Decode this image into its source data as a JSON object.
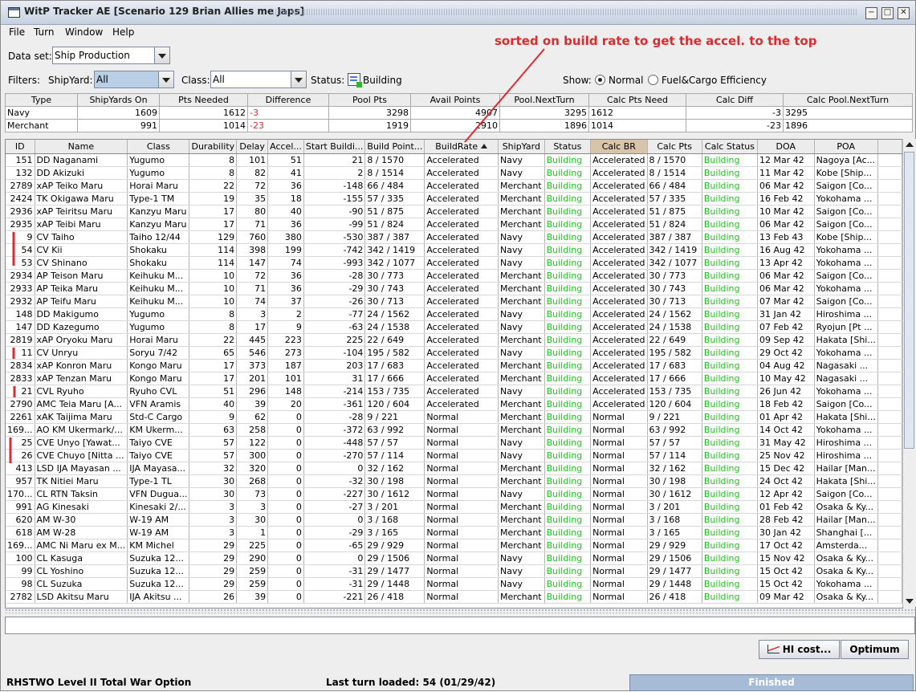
{
  "window": {
    "title": "WitP Tracker AE [Scenario 129 Brian Allies me Japs]"
  },
  "menu": [
    "File",
    "Turn",
    "Window",
    "Help"
  ],
  "annotation": "sorted on build rate to get the accel. to the  top",
  "dataset": {
    "label": "Data set:",
    "value": "Ship Production"
  },
  "filters": {
    "label": "Filters:",
    "shipyard_label": "ShipYard:",
    "shipyard_value": "All",
    "class_label": "Class:",
    "class_value": "All",
    "status_label": "Status:",
    "status_value": "Building"
  },
  "show": {
    "label": "Show:",
    "normal": "Normal",
    "fuel": "Fuel&Cargo Efficiency"
  },
  "summary": {
    "headers": [
      "Type",
      "ShipYards On",
      "Pts Needed",
      "Difference",
      "Pool Pts",
      "Avail Points",
      "Pool.NextTurn",
      "Calc Pts Need",
      "Calc Diff",
      "Calc Pool.NextTurn"
    ],
    "rows": [
      [
        "Navy",
        "1609",
        "1612",
        "-3",
        "3298",
        "4907",
        "3295",
        "1612",
        "-3",
        "3295"
      ],
      [
        "Merchant",
        "991",
        "1014",
        "-23",
        "1919",
        "2910",
        "1896",
        "1014",
        "-23",
        "1896"
      ]
    ]
  },
  "table": {
    "headers": [
      "ID",
      "Name",
      "Class",
      "Durability",
      "Delay",
      "Accel...",
      "Start Buildi...",
      "Build Point...",
      "BuildRate",
      "ShipYard",
      "Status",
      "Calc BR",
      "Calc Pts",
      "Calc Status",
      "DOA",
      "POA"
    ],
    "rows": [
      [
        "151",
        "DD Naganami",
        "Yugumo",
        "8",
        "101",
        "51",
        "21",
        "8 / 1570",
        "Accelerated",
        "Navy",
        "Building",
        "Accelerated",
        "8 / 1570",
        "Building",
        "12 Mar 42",
        "Nagoya [Ac..."
      ],
      [
        "132",
        "DD Akizuki",
        "Yugumo",
        "8",
        "82",
        "41",
        "2",
        "8 / 1514",
        "Accelerated",
        "Navy",
        "Building",
        "Accelerated",
        "8 / 1514",
        "Building",
        "11 Mar 42",
        "Kobe [Ship..."
      ],
      [
        "2789",
        "xAP Teiko Maru",
        "Horai Maru",
        "22",
        "72",
        "36",
        "-148",
        "66 / 484",
        "Accelerated",
        "Merchant",
        "Building",
        "Accelerated",
        "66 / 484",
        "Building",
        "06 Mar 42",
        "Saigon [Co..."
      ],
      [
        "2424",
        "TK Okigawa Maru",
        "Type-1 TM",
        "19",
        "35",
        "18",
        "-155",
        "57 / 335",
        "Accelerated",
        "Merchant",
        "Building",
        "Accelerated",
        "57 / 335",
        "Building",
        "16 Feb 42",
        "Yokohama ..."
      ],
      [
        "2936",
        "xAP Teiritsu Maru",
        "Kanzyu Maru",
        "17",
        "80",
        "40",
        "-90",
        "51 / 875",
        "Accelerated",
        "Merchant",
        "Building",
        "Accelerated",
        "51 / 875",
        "Building",
        "10 Mar 42",
        "Saigon [Co..."
      ],
      [
        "2935",
        "xAP Teibi Maru",
        "Kanzyu Maru",
        "17",
        "71",
        "36",
        "-99",
        "51 / 824",
        "Accelerated",
        "Merchant",
        "Building",
        "Accelerated",
        "51 / 824",
        "Building",
        "06 Mar 42",
        "Saigon [Co..."
      ],
      [
        "9",
        "CV Taiho",
        "Taiho 12/44",
        "129",
        "760",
        "380",
        "-530",
        "387 / 387",
        "Accelerated",
        "Navy",
        "Building",
        "Accelerated",
        "387 / 387",
        "Building",
        "13 Feb 43",
        "Kobe [Ship..."
      ],
      [
        "54",
        "CV Kii",
        "Shokaku",
        "114",
        "398",
        "199",
        "-742",
        "342 / 1419",
        "Accelerated",
        "Navy",
        "Building",
        "Accelerated",
        "342 / 1419",
        "Building",
        "16 Aug 42",
        "Yokohama ..."
      ],
      [
        "53",
        "CV Shinano",
        "Shokaku",
        "114",
        "147",
        "74",
        "-993",
        "342 / 1077",
        "Accelerated",
        "Navy",
        "Building",
        "Accelerated",
        "342 / 1077",
        "Building",
        "13 Apr 42",
        "Yokohama ..."
      ],
      [
        "2934",
        "AP Teison Maru",
        "Keihuku M...",
        "10",
        "72",
        "36",
        "-28",
        "30 / 773",
        "Accelerated",
        "Merchant",
        "Building",
        "Accelerated",
        "30 / 773",
        "Building",
        "06 Mar 42",
        "Saigon [Co..."
      ],
      [
        "2933",
        "AP Teika Maru",
        "Keihuku M...",
        "10",
        "71",
        "36",
        "-29",
        "30 / 743",
        "Accelerated",
        "Merchant",
        "Building",
        "Accelerated",
        "30 / 743",
        "Building",
        "06 Mar 42",
        "Yokohama ..."
      ],
      [
        "2932",
        "AP Teifu Maru",
        "Keihuku M...",
        "10",
        "74",
        "37",
        "-26",
        "30 / 713",
        "Accelerated",
        "Merchant",
        "Building",
        "Accelerated",
        "30 / 713",
        "Building",
        "07 Mar 42",
        "Saigon [Co..."
      ],
      [
        "148",
        "DD Makigumo",
        "Yugumo",
        "8",
        "3",
        "2",
        "-77",
        "24 / 1562",
        "Accelerated",
        "Navy",
        "Building",
        "Accelerated",
        "24 / 1562",
        "Building",
        "31 Jan 42",
        "Hiroshima ..."
      ],
      [
        "147",
        "DD Kazegumo",
        "Yugumo",
        "8",
        "17",
        "9",
        "-63",
        "24 / 1538",
        "Accelerated",
        "Navy",
        "Building",
        "Accelerated",
        "24 / 1538",
        "Building",
        "07 Feb 42",
        "Ryojun [Pt ..."
      ],
      [
        "2819",
        "xAP Oryoku Maru",
        "Horai Maru",
        "22",
        "445",
        "223",
        "225",
        "22 / 649",
        "Accelerated",
        "Merchant",
        "Building",
        "Accelerated",
        "22 / 649",
        "Building",
        "09 Sep 42",
        "Hakata [Shi..."
      ],
      [
        "11",
        "CV Unryu",
        "Soryu 7/42",
        "65",
        "546",
        "273",
        "-104",
        "195 / 582",
        "Accelerated",
        "Navy",
        "Building",
        "Accelerated",
        "195 / 582",
        "Building",
        "29 Oct 42",
        "Yokohama ..."
      ],
      [
        "2834",
        "xAP Konron Maru",
        "Kongo Maru",
        "17",
        "373",
        "187",
        "203",
        "17 / 683",
        "Accelerated",
        "Merchant",
        "Building",
        "Accelerated",
        "17 / 683",
        "Building",
        "04 Aug 42",
        "Nagasaki ..."
      ],
      [
        "2833",
        "xAP Tenzan Maru",
        "Kongo Maru",
        "17",
        "201",
        "101",
        "31",
        "17 / 666",
        "Accelerated",
        "Merchant",
        "Building",
        "Accelerated",
        "17 / 666",
        "Building",
        "10 May 42",
        "Nagasaki ..."
      ],
      [
        "21",
        "CVL Ryuho",
        "Ryuho CVL",
        "51",
        "296",
        "148",
        "-214",
        "153 / 735",
        "Accelerated",
        "Navy",
        "Building",
        "Accelerated",
        "153 / 735",
        "Building",
        "26 Jun 42",
        "Yokohama ..."
      ],
      [
        "2790",
        "AMC Teia Maru [A...",
        "VFN Aramis",
        "40",
        "39",
        "20",
        "-361",
        "120 / 604",
        "Accelerated",
        "Merchant",
        "Building",
        "Accelerated",
        "120 / 604",
        "Building",
        "18 Feb 42",
        "Saigon [Co..."
      ],
      [
        "2261",
        "xAK Taijima Maru",
        "Std-C Cargo",
        "9",
        "62",
        "0",
        "-28",
        "9 / 221",
        "Normal",
        "Merchant",
        "Building",
        "Normal",
        "9 / 221",
        "Building",
        "01 Apr 42",
        "Hakata [Shi..."
      ],
      [
        "169...",
        "AO KM Ukermark/...",
        "KM Ukerm...",
        "63",
        "258",
        "0",
        "-372",
        "63 / 992",
        "Normal",
        "Merchant",
        "Building",
        "Normal",
        "63 / 992",
        "Building",
        "14 Oct 42",
        "Yokohama ..."
      ],
      [
        "25",
        "CVE Unyo [Yawat...",
        "Taiyo CVE",
        "57",
        "122",
        "0",
        "-448",
        "57 / 57",
        "Normal",
        "Navy",
        "Building",
        "Normal",
        "57 / 57",
        "Building",
        "31 May 42",
        "Hiroshima ..."
      ],
      [
        "26",
        "CVE Chuyo [Nitta ...",
        "Taiyo CVE",
        "57",
        "300",
        "0",
        "-270",
        "57 / 114",
        "Normal",
        "Navy",
        "Building",
        "Normal",
        "57 / 114",
        "Building",
        "25 Nov 42",
        "Hiroshima ..."
      ],
      [
        "413",
        "LSD IJA Mayasan ...",
        "IJA Mayasa...",
        "32",
        "320",
        "0",
        "0",
        "32 / 162",
        "Normal",
        "Merchant",
        "Building",
        "Normal",
        "32 / 162",
        "Building",
        "15 Dec 42",
        "Hailar [Man..."
      ],
      [
        "957",
        "TK Nitiei Maru",
        "Type-1 TL",
        "30",
        "268",
        "0",
        "-32",
        "30 / 198",
        "Normal",
        "Merchant",
        "Building",
        "Normal",
        "30 / 198",
        "Building",
        "24 Oct 42",
        "Hakata [Shi..."
      ],
      [
        "170...",
        "CL RTN Taksin",
        "VFN Dugua...",
        "30",
        "73",
        "0",
        "-227",
        "30 / 1612",
        "Normal",
        "Navy",
        "Building",
        "Normal",
        "30 / 1612",
        "Building",
        "12 Apr 42",
        "Saigon [Co..."
      ],
      [
        "991",
        "AG Kinesaki",
        "Kinesaki 2/...",
        "3",
        "3",
        "0",
        "-27",
        "3 / 201",
        "Normal",
        "Merchant",
        "Building",
        "Normal",
        "3 / 201",
        "Building",
        "01 Feb 42",
        "Osaka & Ky..."
      ],
      [
        "620",
        "AM W-30",
        "W-19 AM",
        "3",
        "30",
        "0",
        "0",
        "3 / 168",
        "Normal",
        "Merchant",
        "Building",
        "Normal",
        "3 / 168",
        "Building",
        "28 Feb 42",
        "Hailar [Man..."
      ],
      [
        "618",
        "AM W-28",
        "W-19 AM",
        "3",
        "1",
        "0",
        "-29",
        "3 / 165",
        "Normal",
        "Merchant",
        "Building",
        "Normal",
        "3 / 165",
        "Building",
        "30 Jan 42",
        "Shanghai [..."
      ],
      [
        "169...",
        "AMC Ni Maru ex M...",
        "KM Michel",
        "29",
        "225",
        "0",
        "-65",
        "29 / 929",
        "Normal",
        "Merchant",
        "Building",
        "Normal",
        "29 / 929",
        "Building",
        "17 Oct 42",
        "Amsterda..."
      ],
      [
        "100",
        "CL Kasuga",
        "Suzuka 12...",
        "29",
        "290",
        "0",
        "0",
        "29 / 1506",
        "Normal",
        "Navy",
        "Building",
        "Normal",
        "29 / 1506",
        "Building",
        "15 Nov 42",
        "Osaka & Ky..."
      ],
      [
        "99",
        "CL Yoshino",
        "Suzuka 12...",
        "29",
        "259",
        "0",
        "-31",
        "29 / 1477",
        "Normal",
        "Navy",
        "Building",
        "Normal",
        "29 / 1477",
        "Building",
        "15 Oct 42",
        "Osaka & Ky..."
      ],
      [
        "98",
        "CL Suzuka",
        "Suzuka 12...",
        "29",
        "259",
        "0",
        "-31",
        "29 / 1448",
        "Normal",
        "Navy",
        "Building",
        "Normal",
        "29 / 1448",
        "Building",
        "15 Oct 42",
        "Yokohama ..."
      ],
      [
        "2782",
        "LSD Akitsu Maru",
        "IJA Akitsu ...",
        "26",
        "39",
        "0",
        "-221",
        "26 / 418",
        "Normal",
        "Merchant",
        "Building",
        "Normal",
        "26 / 418",
        "Building",
        "09 Mar 42",
        "Osaka & Ky..."
      ]
    ]
  },
  "buttons": {
    "hi_cost": "HI cost...",
    "optimum": "Optimum"
  },
  "footer": {
    "left": "RHSTWO Level II Total War Option",
    "center": "Last turn loaded: 54 (01/29/42)",
    "progress": "Finished"
  },
  "colors": {
    "accent_red": "#e0282f",
    "building_green": "#1cc21c",
    "calc_br_header": "#d8c4a8"
  }
}
